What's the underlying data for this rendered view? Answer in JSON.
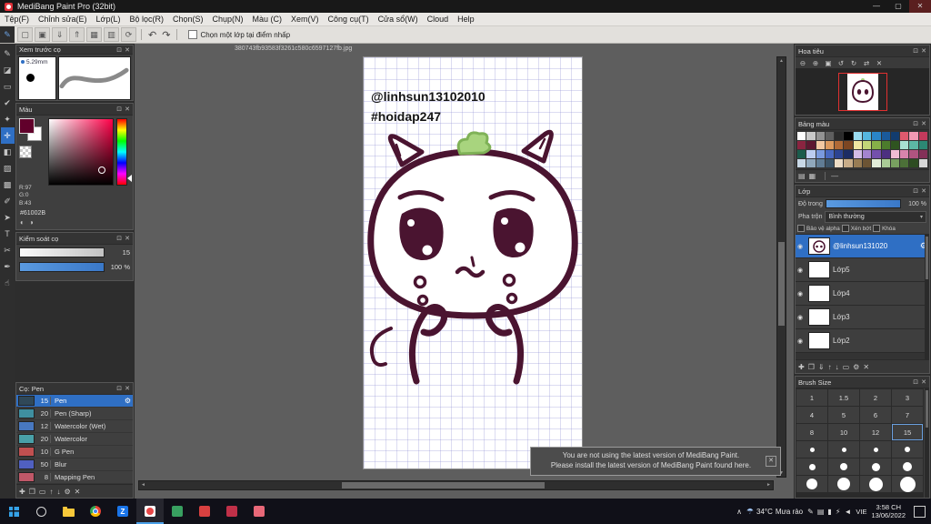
{
  "colors": {
    "selection_blue": "#2f6fc4",
    "ink": "#4a1430",
    "sprout_green": "#a8d47e",
    "view_rect_red": "#e03030"
  },
  "icons": {
    "minimize": "—",
    "maximize": "▢",
    "close": "✕",
    "panel_float": "⊡",
    "panel_close": "✕",
    "undo": "↶",
    "redo": "↷",
    "gear": "⚙",
    "eye": "◉",
    "dropdown_arrow": "▾",
    "scroll_up": "▲",
    "scroll_down": "▼",
    "scroll_left": "◄",
    "scroll_right": "►",
    "weather": "☂",
    "chevron_up": "∧",
    "palette_line": "—",
    "corner_brush": "✎",
    "color_mode_1": "◐",
    "color_mode_2": "◑"
  },
  "titlebar": {
    "title": "MediBang Paint Pro (32bit)"
  },
  "menubar": {
    "items": [
      {
        "name": "menu-file",
        "label": "Tệp(F)"
      },
      {
        "name": "menu-edit",
        "label": "Chỉnh sửa(E)"
      },
      {
        "name": "menu-layer",
        "label": "Lớp(L)"
      },
      {
        "name": "menu-filter",
        "label": "Bộ lọc(R)"
      },
      {
        "name": "menu-select",
        "label": "Chọn(S)"
      },
      {
        "name": "menu-capture",
        "label": "Chụp(N)"
      },
      {
        "name": "menu-color",
        "label": "Màu (C)"
      },
      {
        "name": "menu-view",
        "label": "Xem(V)"
      },
      {
        "name": "menu-tools",
        "label": "Công cụ(T)"
      },
      {
        "name": "menu-window",
        "label": "Cửa sổ(W)"
      },
      {
        "name": "menu-cloud",
        "label": "Cloud"
      },
      {
        "name": "menu-help",
        "label": "Help"
      }
    ]
  },
  "toolbar": {
    "icons": [
      {
        "name": "new-canvas-icon",
        "glyph": "▢"
      },
      {
        "name": "open-file-icon",
        "glyph": "▣"
      },
      {
        "name": "save-icon",
        "glyph": "⇓"
      },
      {
        "name": "export-icon",
        "glyph": "⇑"
      },
      {
        "name": "grid-view-icon",
        "glyph": "▦"
      },
      {
        "name": "snap-settings-icon",
        "glyph": "▥"
      },
      {
        "name": "rotate-canvas-icon",
        "glyph": "⟳"
      }
    ],
    "checkbox_label": "Chọn một lớp tại điểm nhấp"
  },
  "toolstrip": {
    "tools": [
      {
        "name": "brush-tool",
        "glyph": "✎"
      },
      {
        "name": "eraser-tool",
        "glyph": "◪"
      },
      {
        "name": "marquee-tool",
        "glyph": "▭"
      },
      {
        "name": "select-pen-tool",
        "glyph": "✔"
      },
      {
        "name": "magic-wand-tool",
        "glyph": "✦"
      },
      {
        "name": "move-tool",
        "glyph": "✛",
        "active": true
      },
      {
        "name": "bucket-tool",
        "glyph": "◧"
      },
      {
        "name": "gradient-tool",
        "glyph": "▨"
      },
      {
        "name": "pattern-tool",
        "glyph": "▩"
      },
      {
        "name": "eyedropper-tool",
        "glyph": "✐"
      },
      {
        "name": "operation-tool",
        "glyph": "➤"
      },
      {
        "name": "text-tool",
        "glyph": "T"
      },
      {
        "name": "slice-tool",
        "glyph": "✂"
      },
      {
        "name": "pen-tool",
        "glyph": "✒"
      },
      {
        "name": "hand-tool",
        "glyph": "☝"
      }
    ]
  },
  "canvas": {
    "filename": "380743fb93583f3261c580c6597127fb.jpg",
    "annotation_line1": "@linhsun13102010",
    "annotation_line2": "#hoidap247"
  },
  "notification": {
    "line1": "You are not using the latest version of MediBang Paint.",
    "line2": "Please install the latest version of MediBang Paint found here."
  },
  "panels": {
    "brush_preview": {
      "title": "Xem trước cọ",
      "size_label": "5.29mm"
    },
    "color": {
      "title": "Màu",
      "r": "R:97",
      "g": "G:0",
      "b": "B:43",
      "hex": "#61002B"
    },
    "brush_control": {
      "title": "Kiểm soát cọ",
      "size_value": "15",
      "opacity_value": "100 %"
    },
    "brush_list": {
      "title": "Cọ: Pen",
      "brushes": [
        {
          "size": "15",
          "name": "Pen",
          "thumb": "#304858",
          "selected": true
        },
        {
          "size": "20",
          "name": "Pen (Sharp)",
          "thumb": "#3f8fa0"
        },
        {
          "size": "12",
          "name": "Watercolor (Wet)",
          "thumb": "#4878c0"
        },
        {
          "size": "20",
          "name": "Watercolor",
          "thumb": "#49a0a8"
        },
        {
          "size": "10",
          "name": "G Pen",
          "thumb": "#c05050"
        },
        {
          "size": "50",
          "name": "Blur",
          "thumb": "#5060c0"
        },
        {
          "size": "8",
          "name": "Mapping Pen",
          "thumb": "#c05868"
        }
      ],
      "bottom_buttons": [
        {
          "name": "add-brush-button",
          "glyph": "✚"
        },
        {
          "name": "duplicate-brush-button",
          "glyph": "❐"
        },
        {
          "name": "brush-folder-button",
          "glyph": "▭"
        },
        {
          "name": "move-brush-up-button",
          "glyph": "↑"
        },
        {
          "name": "move-brush-down-button",
          "glyph": "↓"
        },
        {
          "name": "brush-settings-button",
          "glyph": "⚙"
        },
        {
          "name": "delete-brush-button",
          "glyph": "✕"
        }
      ]
    },
    "navigator": {
      "title": "Hoa tiêu",
      "buttons": [
        {
          "name": "zoom-out-button",
          "glyph": "⊖"
        },
        {
          "name": "zoom-in-button",
          "glyph": "⊕"
        },
        {
          "name": "fit-view-button",
          "glyph": "▣"
        },
        {
          "name": "rotate-ccw-button",
          "glyph": "↺"
        },
        {
          "name": "rotate-cw-button",
          "glyph": "↻"
        },
        {
          "name": "flip-view-button",
          "glyph": "⇄"
        },
        {
          "name": "reset-view-button",
          "glyph": "✕"
        }
      ]
    },
    "palette": {
      "title": "Bảng màu",
      "swatches": [
        "#ffffff",
        "#c9c9c9",
        "#939393",
        "#5f5f5f",
        "#2b2b2b",
        "#000000",
        "#9adcf0",
        "#55b7e0",
        "#2a85c8",
        "#1a5a9a",
        "#123c6e",
        "#e05a6e",
        "#f29ab4",
        "#c43a5c",
        "#8a2440",
        "#5c1830",
        "#f2c9a2",
        "#dc9a5e",
        "#b06a36",
        "#7c4622",
        "#f0e6a0",
        "#c2d678",
        "#86b048",
        "#4c7c2c",
        "#2f5420",
        "#a8e0d2",
        "#5cb8a4",
        "#2c8874",
        "#1a5c4c",
        "#bccdf0",
        "#7a9ade",
        "#4868c0",
        "#2c4492",
        "#1c2c64",
        "#d2bce8",
        "#a484d0",
        "#7450ac",
        "#4c3080",
        "#f0bcd2",
        "#d884ac",
        "#b05480",
        "#843058",
        "#c8d8e6",
        "#90a8bc",
        "#607c94",
        "#3c5468",
        "#ecdcc6",
        "#c8ac88",
        "#987c54",
        "#6c5434",
        "#e2ecd8",
        "#aacb96",
        "#78a060",
        "#4c7038",
        "#2e4c22",
        "#d8d8d8"
      ],
      "bottom_buttons": [
        {
          "name": "add-palette-color-button",
          "glyph": "▤"
        },
        {
          "name": "delete-palette-color-button",
          "glyph": "▦"
        }
      ]
    },
    "layers": {
      "title": "Lớp",
      "opacity_label": "Độ trong",
      "opacity_value": "100 %",
      "blend_label": "Pha trộn",
      "blend_value": "Bình thường",
      "check_labels": [
        "Bảo vệ alpha",
        "Xén bớt",
        "Khóa"
      ],
      "items": [
        {
          "name": "@linhsun131020",
          "selected": true
        },
        {
          "name": "Lớp5"
        },
        {
          "name": "Lớp4"
        },
        {
          "name": "Lớp3"
        },
        {
          "name": "Lớp2"
        }
      ],
      "bottom_buttons": [
        {
          "name": "add-layer-button",
          "glyph": "✚"
        },
        {
          "name": "duplicate-layer-button",
          "glyph": "❐"
        },
        {
          "name": "merge-layer-button",
          "glyph": "⇓"
        },
        {
          "name": "move-layer-up-button",
          "glyph": "↑"
        },
        {
          "name": "move-layer-down-button",
          "glyph": "↓"
        },
        {
          "name": "layer-folder-button",
          "glyph": "▭"
        },
        {
          "name": "layer-settings-button",
          "glyph": "⚙"
        },
        {
          "name": "delete-layer-button",
          "glyph": "✕"
        }
      ]
    },
    "brush_size": {
      "title": "Brush Size",
      "number_cells": [
        "1",
        "1.5",
        "2",
        "3",
        "4",
        "5",
        "6",
        "7",
        "8",
        "10",
        "12",
        "15"
      ],
      "selected": "15",
      "dot_cells": [
        20,
        25,
        30,
        35,
        40,
        45,
        50,
        60,
        70,
        80,
        90,
        100
      ]
    }
  },
  "taskbar": {
    "apps": [
      {
        "name": "start-button",
        "type": "start"
      },
      {
        "name": "search-button",
        "type": "search"
      },
      {
        "name": "file-explorer-button",
        "type": "folder"
      },
      {
        "name": "chrome-button",
        "type": "chrome"
      },
      {
        "name": "zalo-button",
        "color": "#1a74e8",
        "label": "Z"
      },
      {
        "name": "medibang-button",
        "type": "medibang",
        "active": true
      },
      {
        "name": "app-button-1",
        "color": "#38a060",
        "label": ""
      },
      {
        "name": "app-button-2",
        "color": "#d84040",
        "label": ""
      },
      {
        "name": "app-button-3",
        "color": "#c03048",
        "label": ""
      },
      {
        "name": "app-button-4",
        "color": "#e86878",
        "label": ""
      }
    ],
    "tray_icons": [
      {
        "name": "pen-pressure-icon",
        "glyph": "✎"
      },
      {
        "name": "tablet-driver-icon",
        "glyph": "▤"
      },
      {
        "name": "battery-icon",
        "glyph": "▮"
      },
      {
        "name": "usb-device-icon",
        "glyph": "⚡"
      },
      {
        "name": "volume-icon",
        "glyph": "◄"
      }
    ],
    "weather_temp": "34°C",
    "weather_desc": "Mưa rào",
    "language": "VIE",
    "time": "3:58 CH",
    "date": "13/06/2022"
  }
}
